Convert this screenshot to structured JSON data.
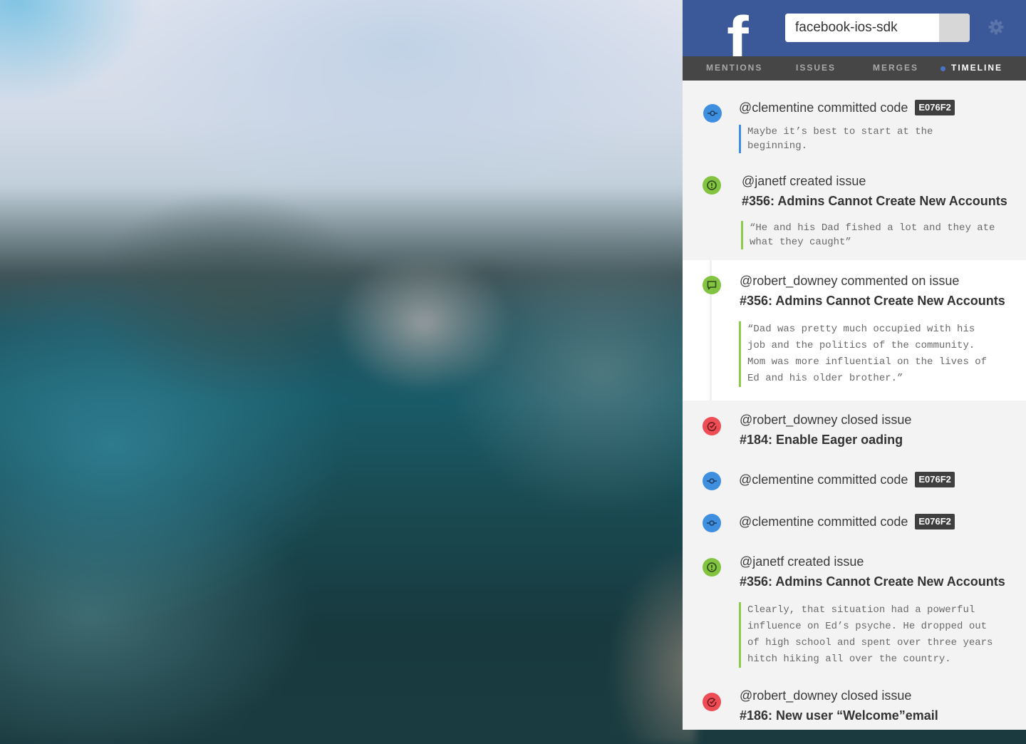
{
  "header": {
    "logo": "f",
    "search_value": "facebook-ios-sdk"
  },
  "tabs": [
    {
      "label": "MENTIONS",
      "active": false
    },
    {
      "label": "ISSUES",
      "active": false
    },
    {
      "label": "MERGES",
      "active": false
    },
    {
      "label": "TIMELINE",
      "active": true
    }
  ],
  "colors": {
    "brand": "#3b5998",
    "commit": "#3f8fe0",
    "issue": "#82c341",
    "closed": "#ef4d55",
    "tabbar": "#464646"
  },
  "feed": [
    {
      "icon": "commit-icon",
      "text": "@clementine committed code",
      "badge": "E076F2",
      "quote": "Maybe it’s best to start at the\nbeginning."
    },
    {
      "icon": "issue-opened-icon",
      "text": "@janetf created issue",
      "title": "#356: Admins Cannot Create New Accounts",
      "quote": "“He and his Dad fished a lot and they ate\nwhat they caught”"
    },
    {
      "icon": "comment-icon",
      "text": "@robert_downey commented on issue",
      "title": "#356: Admins Cannot Create New Accounts",
      "quote": "“Dad was pretty much occupied with his\njob and the politics of the community.\nMom was more influential on the lives of\nEd and his older brother.”"
    },
    {
      "icon": "issue-closed-icon",
      "text": "@robert_downey closed issue",
      "title": "#184: Enable Eager oading"
    },
    {
      "icon": "commit-icon",
      "text": "@clementine committed code",
      "badge": "E076F2"
    },
    {
      "icon": "commit-icon",
      "text": "@clementine committed code",
      "badge": "E076F2"
    },
    {
      "icon": "issue-opened-icon",
      "text": "@janetf created issue",
      "title": "#356: Admins Cannot Create New Accounts",
      "quote": "Clearly, that situation had a powerful\ninfluence on Ed’s psyche. He dropped out\nof high school and spent over three years\nhitch hiking all over the country."
    },
    {
      "icon": "issue-closed-icon",
      "text": "@robert_downey closed issue",
      "title": "#186: New user “Welcome”email"
    }
  ]
}
